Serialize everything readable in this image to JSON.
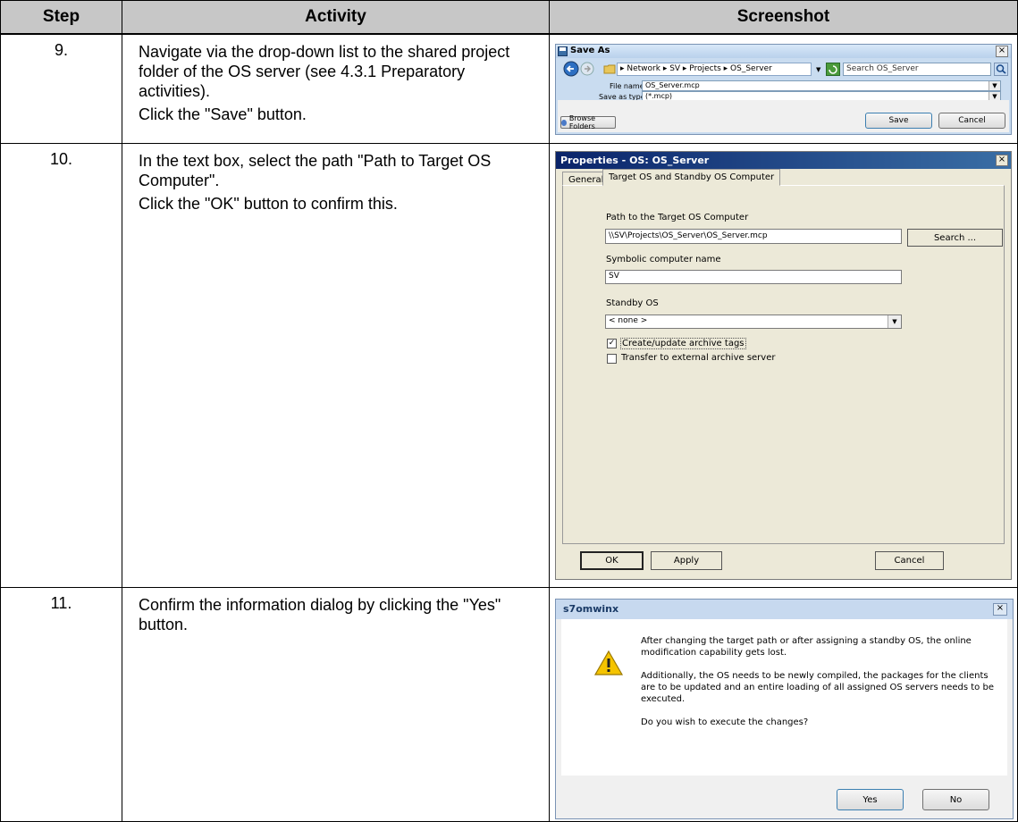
{
  "table": {
    "headers": {
      "step": "Step",
      "activity": "Activity",
      "screenshot": "Screenshot"
    },
    "rows": [
      {
        "step": "9.",
        "activity": [
          "Navigate via the drop-down list to the shared project folder of the OS server (see 4.3.1 Preparatory activities).",
          "Click the \"Save\" button."
        ]
      },
      {
        "step": "10.",
        "activity": [
          "In the text box, select the path \"Path to Target OS Computer\".",
          "Click the \"OK\" button to confirm this."
        ]
      },
      {
        "step": "11.",
        "activity": [
          "Confirm the information dialog by clicking the \"Yes\" button."
        ]
      }
    ]
  },
  "save_as": {
    "title": "Save As",
    "breadcrumb": "▸ Network ▸ SV ▸ Projects ▸ OS_Server",
    "search_placeholder": "Search OS_Server",
    "file_name_label": "File name:",
    "file_name_value": "OS_Server.mcp",
    "save_type_label": "Save as type:",
    "save_type_value": "(*.mcp)",
    "browse_folders": "Browse Folders",
    "save_button": "Save",
    "cancel_button": "Cancel"
  },
  "properties": {
    "title": "Properties - OS: OS_Server",
    "tabs": [
      "General",
      "Target OS and Standby OS Computer"
    ],
    "path_label": "Path to the Target OS Computer",
    "path_value": "\\\\SV\\Projects\\OS_Server\\OS_Server.mcp",
    "search_button": "Search ...",
    "symbolic_label": "Symbolic computer name",
    "symbolic_value": "SV",
    "standby_label": "Standby OS",
    "standby_value": "< none >",
    "check_create": "Create/update archive tags",
    "check_create_checked": true,
    "check_transfer": "Transfer to external archive server",
    "check_transfer_checked": false,
    "ok_button": "OK",
    "apply_button": "Apply",
    "cancel_button": "Cancel"
  },
  "message": {
    "title": "s7omwinx",
    "paragraphs": [
      "After changing the target path or after assigning a standby OS, the online modification capability gets lost.",
      "Additionally, the OS needs to be newly compiled, the packages for the clients are to be updated and an entire loading of all assigned OS servers needs to be executed.",
      "Do you wish to execute the changes?"
    ],
    "yes_button": "Yes",
    "no_button": "No"
  }
}
